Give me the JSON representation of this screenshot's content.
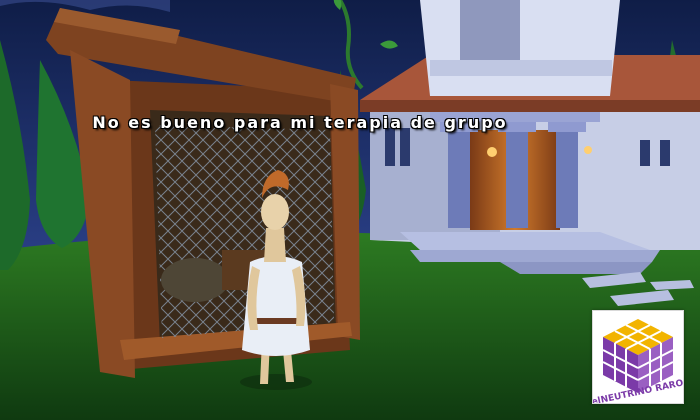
{
  "game": {
    "dialogue": {
      "line": "No es bueno para mi terapia de grupo"
    },
    "watermark": {
      "brand": "elNEUTRINO RARO",
      "icon": "cube-logo-icon"
    }
  },
  "colors": {
    "sky": "#1c2e66",
    "grass": "#2f7a24",
    "wood": "#8a4a24",
    "wall": "#c8cfe6",
    "roof": "#a8563a",
    "lamp": "#ffb040",
    "subtitle_text": "#ffffff"
  }
}
